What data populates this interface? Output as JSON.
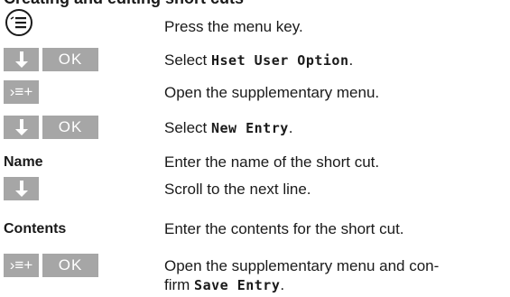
{
  "page": {
    "clipped_heading": "Creating and editing short cuts"
  },
  "steps": [
    {
      "left_kind": "menu-key",
      "desc_parts": [
        {
          "text": "Press the menu key.",
          "mono": false
        }
      ]
    },
    {
      "left_kind": "arrow-ok",
      "keys": {
        "ok": "OK"
      },
      "desc_parts": [
        {
          "text": "Select ",
          "mono": false
        },
        {
          "text": "Hset User Option",
          "mono": true
        },
        {
          "text": ".",
          "mono": false
        }
      ]
    },
    {
      "left_kind": "supp",
      "keys": {
        "supp": "›≡+"
      },
      "desc_parts": [
        {
          "text": "Open the supplementary menu.",
          "mono": false
        }
      ]
    },
    {
      "left_kind": "arrow-ok",
      "keys": {
        "ok": "OK"
      },
      "desc_parts": [
        {
          "text": "Select ",
          "mono": false
        },
        {
          "text": "New Entry",
          "mono": true
        },
        {
          "text": ".",
          "mono": false
        }
      ]
    },
    {
      "left_kind": "label",
      "label": "Name",
      "desc_parts": [
        {
          "text": "Enter the name of the short cut.",
          "mono": false
        }
      ]
    },
    {
      "left_kind": "arrow",
      "desc_parts": [
        {
          "text": "Scroll to the next line.",
          "mono": false
        }
      ]
    },
    {
      "left_kind": "label",
      "label": "Contents",
      "desc_parts": [
        {
          "text": "Enter the contents for the short cut.",
          "mono": false
        }
      ]
    },
    {
      "left_kind": "supp-ok",
      "keys": {
        "supp": "›≡+",
        "ok": "OK"
      },
      "desc_parts": [
        {
          "text": "Open the supplementary menu and con-",
          "mono": false
        },
        {
          "text": "\n",
          "mono": false
        },
        {
          "text": "firm ",
          "mono": false
        },
        {
          "text": "Save Entry",
          "mono": true
        },
        {
          "text": ".",
          "mono": false
        }
      ]
    }
  ]
}
